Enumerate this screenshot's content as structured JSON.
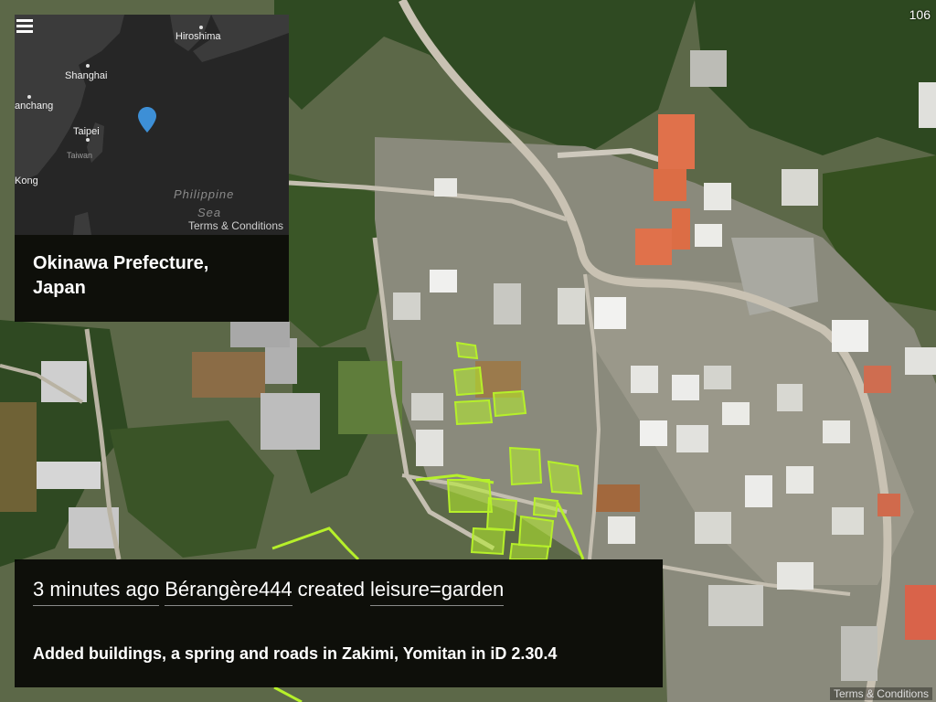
{
  "counter": "106",
  "attribution": "Terms & Conditions",
  "overview": {
    "menu_icon": "hamburger-menu-icon",
    "marker_icon": "map-pin-icon",
    "marker_color": "#3d8fd6",
    "terms": "Terms & Conditions",
    "cities": [
      "Hiroshima",
      "Shanghai",
      "anchang",
      "Taipei",
      "Kong"
    ],
    "country": "Taiwan",
    "sea": "Philippine",
    "sea_cut": "Sea",
    "location_line1": "Okinawa Prefecture,",
    "location_line2": "Japan"
  },
  "change": {
    "time": "3 minutes ago",
    "user": "Bérangère444",
    "action": "created",
    "tag": "leisure=garden",
    "comment": "Added buildings, a spring and roads in Zakimi, Yomitan in iD 2.30.4"
  },
  "colors": {
    "highlight": "#b6f02a",
    "panel_bg": "#000000",
    "roof_orange": "#e0714b"
  }
}
